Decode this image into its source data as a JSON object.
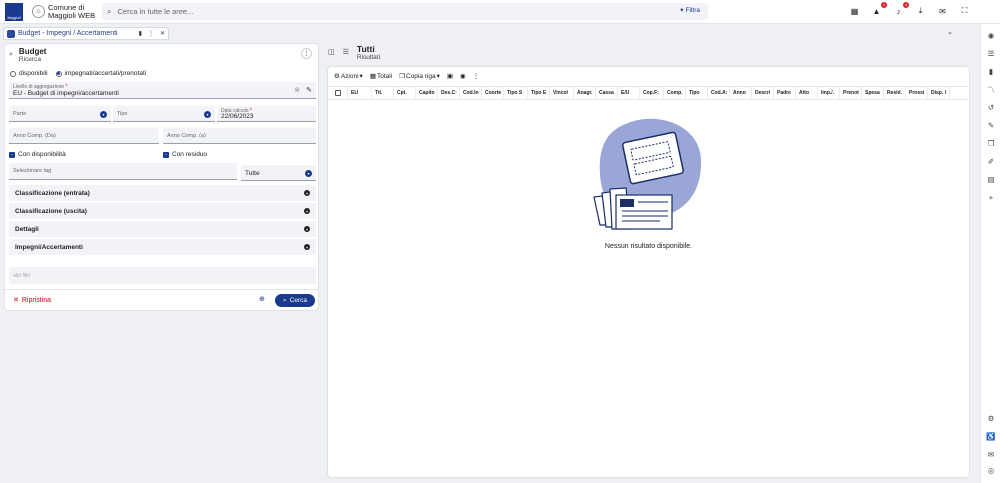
{
  "app": {
    "logo_text": "Maggioli",
    "org_line1": "Comune di",
    "org_line2": "Maggioli WEB",
    "search_placeholder": "Cerca in tutte le aree...",
    "filter_label": "Filtra",
    "notif_badge_1": "1",
    "notif_badge_2": "4"
  },
  "tab": {
    "label": "Budget - Impegni / Accertamenti"
  },
  "search_panel": {
    "title": "Budget",
    "subtitle": "Ricerca",
    "radio_1": "disponibili",
    "radio_2": "impegnati/accertati/prenotati",
    "radio_selected": "impegnati/accertati/prenotati",
    "livello_label": "Livello di aggregazione",
    "livello_value": "EU - Budget di impegni/accertamenti",
    "parte_label": "Parte",
    "tipo_label": "Tipo",
    "data_calcolo_label": "Data calcolo",
    "data_calcolo_value": "22/06/2023",
    "anno_comp_da": "Anno Comp. (Da)",
    "anno_comp_a": "Anno Comp. (a)",
    "con_disponibilita": "Con disponibilità",
    "con_residuo": "Con residuo",
    "tag_placeholder": "Selezionare tag",
    "tag_mode": "Tutte",
    "sections": [
      "Classificazione (entrata)",
      "Classificazione (uscita)",
      "Dettagli",
      "Impegni/Accertamenti"
    ],
    "altri_filtri": "altri filtri",
    "reset_label": "Ripristina",
    "search_label": "Cerca"
  },
  "results": {
    "title": "Tutti",
    "subtitle": "Risultati",
    "toolbar": {
      "actions": "Azioni",
      "totals": "Totali",
      "copy_row": "Copia riga"
    },
    "columns": [
      "EU",
      "Tit.",
      "Cpt.",
      "Capito",
      "Des.C:",
      "Cod.In",
      "Coorte",
      "Tipo S",
      "Tipo E",
      "Vincol",
      "Anagr.",
      "Cassa",
      "E/U",
      "Cop.F;",
      "Comp.",
      "Tipo",
      "Cod.A:",
      "Anno",
      "Descri",
      "Padre",
      "Atto",
      "Imp./.",
      "Prenot",
      "Spesa",
      "Resid.",
      "Prossi",
      "Disp. l"
    ],
    "empty_message": "Nessun risultato disponibile."
  }
}
